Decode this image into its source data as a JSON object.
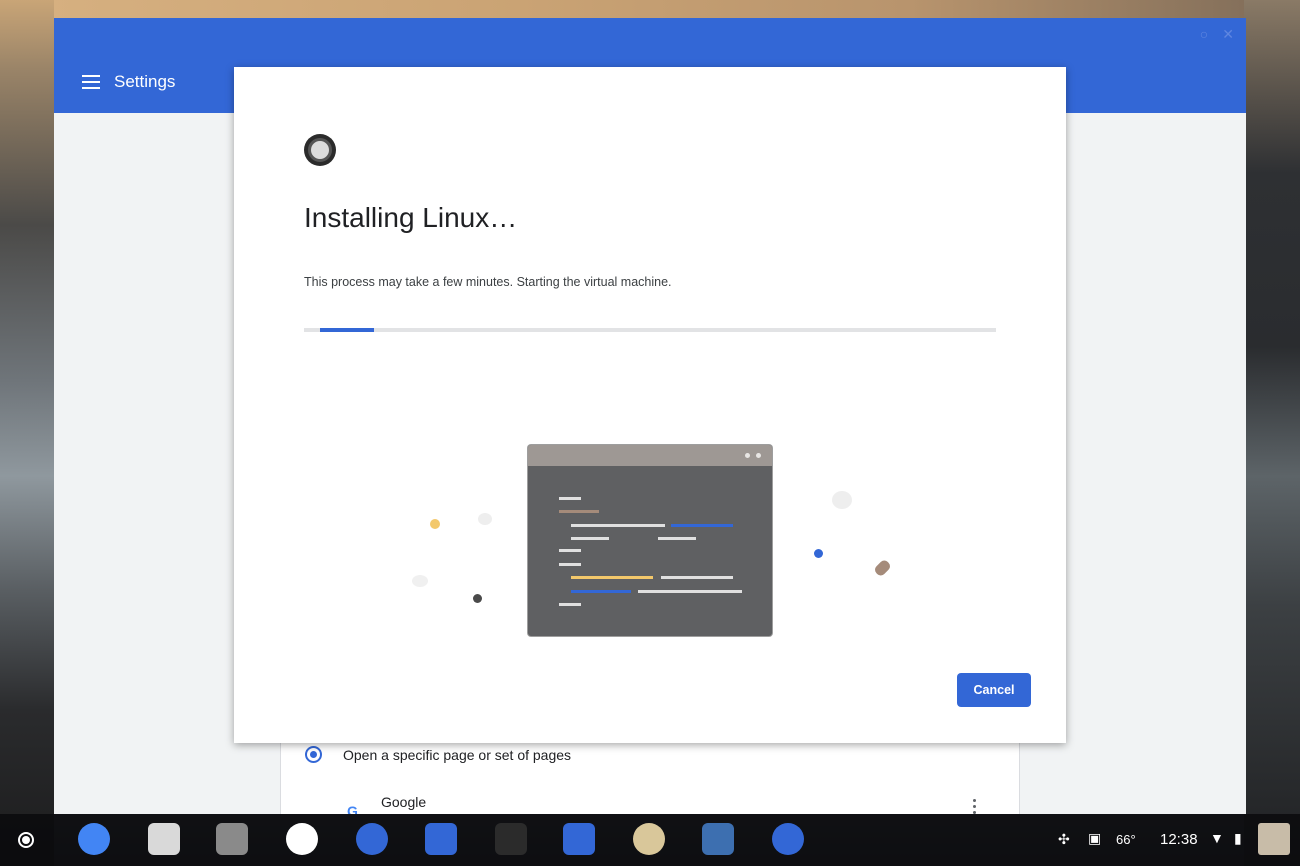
{
  "settings_window": {
    "title": "Settings",
    "startup_option": "Open a specific page or set of pages",
    "site_name": "Google",
    "site_icon": "G"
  },
  "dialog": {
    "title": "Installing Linux…",
    "message": "This process may take a few minutes. Starting the virtual machine.",
    "progress": 0.08,
    "cancel_label": "Cancel"
  },
  "shelf": {
    "apps": [
      {
        "name": "chrome-icon",
        "color": "#4285f4"
      },
      {
        "name": "gmail-icon",
        "color": "#d9d9d9"
      },
      {
        "name": "youtube-icon",
        "color": "#8a8a8a"
      },
      {
        "name": "play-store-icon",
        "color": "#ffffff"
      },
      {
        "name": "files-icon",
        "color": "#3367d6"
      },
      {
        "name": "bookmark-app-icon",
        "color": "#3367d6"
      },
      {
        "name": "wu-app-icon",
        "color": "#2b2b2b"
      },
      {
        "name": "mail-app-icon",
        "color": "#3367d6"
      },
      {
        "name": "duckduckgo-icon",
        "color": "#d9c79a"
      },
      {
        "name": "news-app-icon",
        "color": "#3d6fb0"
      },
      {
        "name": "settings-app-icon",
        "color": "#3367d6"
      }
    ],
    "temperature": "66°",
    "time": "12:38"
  },
  "colors": {
    "accent": "#3367d6"
  }
}
